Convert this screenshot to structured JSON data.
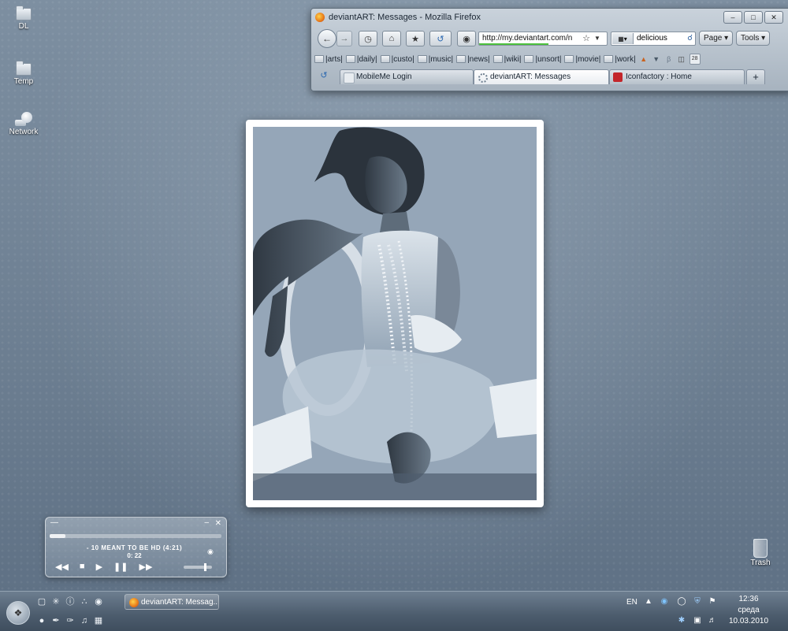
{
  "desktop": {
    "icons": [
      {
        "label": "DL",
        "icon": "folder-icon"
      },
      {
        "label": "Temp",
        "icon": "folder-icon"
      },
      {
        "label": "Network",
        "icon": "network-icon"
      }
    ],
    "trash": {
      "label": "Trash",
      "icon": "trash-icon"
    }
  },
  "browser": {
    "title": "deviantART: Messages - Mozilla Firefox",
    "url": "http://my.deviantart.com/n",
    "search_value": "delicious",
    "page_label": "Page",
    "tools_label": "Tools",
    "bookmarks": [
      "|arts|",
      "|daily|",
      "|custo|",
      "|music|",
      "|news|",
      "|wiki|",
      "|unsort|",
      "|movie|",
      "|work|"
    ],
    "tabs": [
      {
        "label": "MobileMe Login",
        "active": false
      },
      {
        "label": "deviantART: Messages",
        "active": true
      },
      {
        "label": "Iconfactory : Home",
        "active": false
      }
    ],
    "new_tab": "+"
  },
  "player": {
    "track": "- 10 MEANT TO BE HD (4:21)",
    "time": "0: 22",
    "progress": 0.09,
    "volume": 0.75
  },
  "taskbar": {
    "task_label": "deviantART: Messag...",
    "language": "EN",
    "clock_time": "12:36",
    "clock_day": "среда",
    "clock_date": "10.03.2010"
  },
  "colors": {
    "desktop": "#6f8193",
    "taskbar": "#4c5c6d",
    "url_progress": "#4cc03c"
  }
}
